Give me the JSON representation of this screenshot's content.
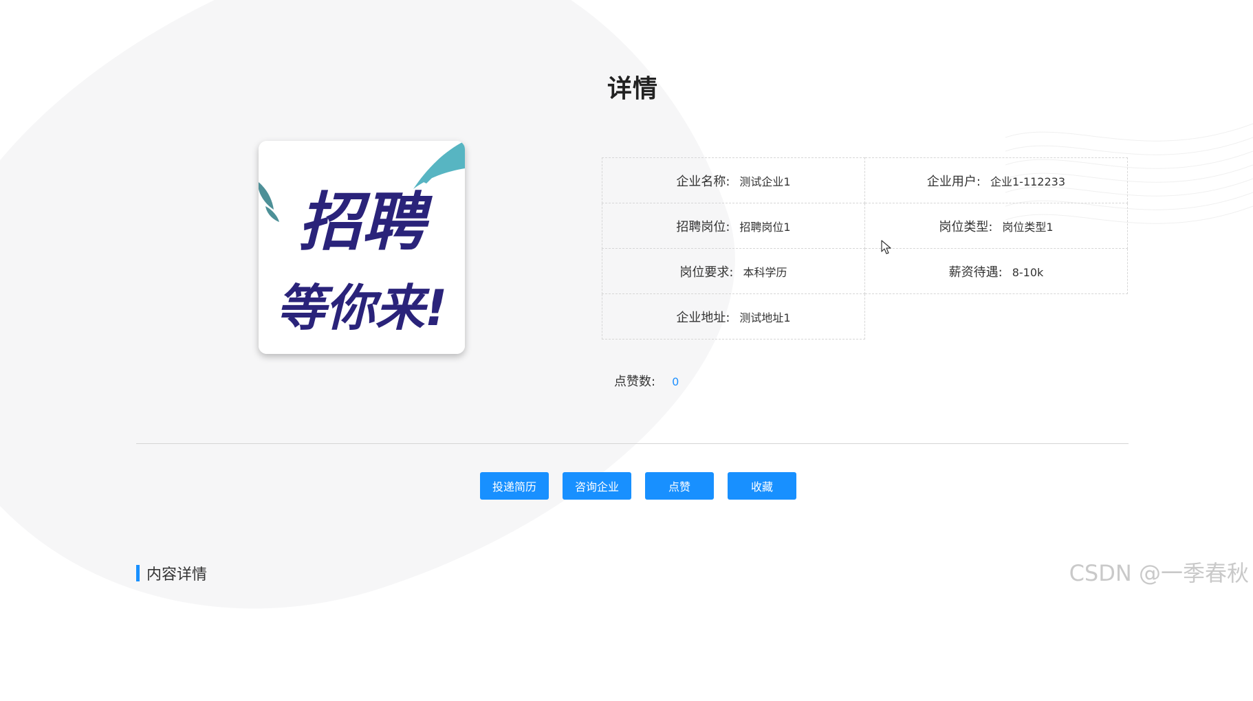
{
  "page": {
    "title": "详情"
  },
  "poster": {
    "line1": "招聘",
    "line2": "等你来!",
    "accent_color": "#2a237a"
  },
  "info": {
    "rows": [
      [
        {
          "label": "企业名称:",
          "value": "测试企业1"
        },
        {
          "label": "企业用户:",
          "value": "企业1-112233"
        }
      ],
      [
        {
          "label": "招聘岗位:",
          "value": "招聘岗位1"
        },
        {
          "label": "岗位类型:",
          "value": "岗位类型1"
        }
      ],
      [
        {
          "label": "岗位要求:",
          "value": "本科学历"
        },
        {
          "label": "薪资待遇:",
          "value": "8-10k"
        }
      ],
      [
        {
          "label": "企业地址:",
          "value": "测试地址1"
        }
      ]
    ]
  },
  "likes": {
    "label": "点赞数:",
    "value": "0"
  },
  "actions": {
    "submit_resume": "投递简历",
    "consult_company": "咨询企业",
    "like": "点赞",
    "favorite": "收藏"
  },
  "section": {
    "content_title": "内容详情"
  },
  "watermark": {
    "text": "CSDN @一季春秋"
  },
  "colors": {
    "primary": "#1890ff",
    "link": "#1e90ff"
  }
}
